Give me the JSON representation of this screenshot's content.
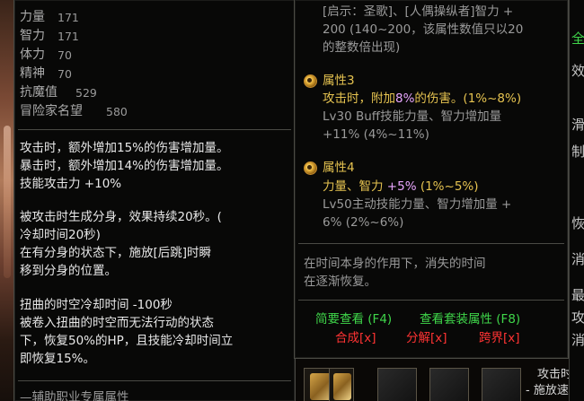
{
  "left_panel": {
    "stats": [
      {
        "label": "力量",
        "value": "171"
      },
      {
        "label": "智力",
        "value": "171"
      },
      {
        "label": "体力",
        "value": "70"
      },
      {
        "label": "精神",
        "value": "70"
      },
      {
        "label": "抗魔值",
        "value": "529"
      },
      {
        "label": "冒险家名望",
        "value": "580"
      }
    ],
    "effects_a": [
      "攻击时，额外增加15%的伤害增加量。",
      "暴击时，额外增加14%的伤害增加量。",
      "技能攻击力 +10%"
    ],
    "effects_b": [
      "被攻击时生成分身，效果持续20秒。(",
      "冷却时间20秒)",
      "在有分身的状态下，施放[后跳]时瞬",
      "移到分身的位置。"
    ],
    "effects_c": [
      "扭曲的时空冷却时间 -100秒",
      "被卷入扭曲的时空而无法行动的状态",
      "下，恢复50%的HP，且技能冷却时间立",
      "即恢复15%。"
    ],
    "footer_partial": "—辅助职业专属属性"
  },
  "right_panel": {
    "top_lines": [
      "[启示：圣歌]、[人偶操纵者]智力 +",
      "200 (140~200，该属性数值只以20",
      "的整数倍出现)"
    ],
    "attr3": {
      "title": "属性3",
      "line1_prefix": "攻击时，附加",
      "line1_highlight": "8%",
      "line1_suffix": "的伤害。(1%~8%)",
      "line2": "Lv30 Buff技能力量、智力增加量",
      "line3": "+11% (4%~11%)"
    },
    "attr4": {
      "title": "属性4",
      "line1_prefix": "力量、智力 ",
      "line1_highlight": "+5%",
      "line1_suffix": " (1%~5%)",
      "line2": "Lv50主动技能力量、智力增加量 +",
      "line3": "6% (2%~6%)"
    },
    "flavor": [
      "在时间本身的作用下，消失的时间",
      "在逐渐恢复。"
    ],
    "links": {
      "brief": "简要查看 (F4)",
      "set": "查看套装属性 (F8)",
      "synth": "合成[x]",
      "decompose": "分解[x]",
      "cross": "跨界[x]"
    }
  },
  "edge_panel": {
    "chars": [
      "全",
      "效",
      "滑",
      "制",
      "恢",
      "消",
      "最",
      "攻",
      "消"
    ],
    "bottom_text": [
      "攻击时",
      "- 施放速"
    ]
  },
  "colors": {
    "gold": "#e6c350",
    "purple": "#e9a6ff",
    "green": "#3fd64a",
    "red": "#ff3333"
  }
}
